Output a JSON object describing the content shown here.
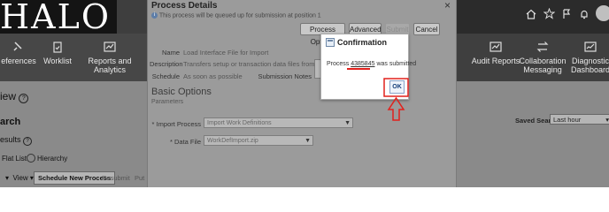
{
  "app": {
    "logo_text": "HALO"
  },
  "left_nav": [
    {
      "label": "eferences",
      "icon": "preferences-icon"
    },
    {
      "label": "Worklist",
      "icon": "clipboard-icon"
    },
    {
      "label": "Reports and Analytics",
      "icon": "chart-icon"
    }
  ],
  "left_panel": {
    "view_label": "iew",
    "search_label": "arch",
    "results_label": "esults",
    "flat_list": "Flat List",
    "hierarchy": "Hierarchy",
    "view_menu": "View",
    "schedule_button": "Schedule New Process",
    "resubmit_button": "Resubmit",
    "put_button": "Put"
  },
  "right_nav": [
    {
      "label": "Audit Reports",
      "icon": "audit-icon"
    },
    {
      "label": "Collaboration Messaging",
      "icon": "arrows-icon"
    },
    {
      "label": "Diagnostic Dashboard",
      "icon": "dashboard-icon"
    }
  ],
  "right_panel": {
    "saved_search_label": "Saved Search",
    "saved_search_value": "Last hour"
  },
  "process_details": {
    "title": "Process Details",
    "info": "This process will be queued up for submission at position 1",
    "buttons": {
      "process_options": "Process Options",
      "advanced": "Advanced",
      "submit": "Submit",
      "cancel": "Cancel"
    },
    "name_label": "Name",
    "name_value": "Load Interface File for Import",
    "description_label": "Description",
    "description_value": "Transfers setup or transaction data files from",
    "schedule_label": "Schedule",
    "schedule_value": "As soon as possible",
    "submission_notes_label": "Submission Notes",
    "basic_options_title": "Basic Options",
    "parameters_label": "Parameters",
    "import_process_label": "Import Process",
    "import_process_value": "Import Work Definitions",
    "data_file_label": "Data File",
    "data_file_value": "WorkDefImport.zip"
  },
  "confirmation": {
    "title": "Confirmation",
    "message_prefix": "Process ",
    "process_id": "4385845",
    "message_suffix": " was submitted",
    "ok": "OK"
  }
}
